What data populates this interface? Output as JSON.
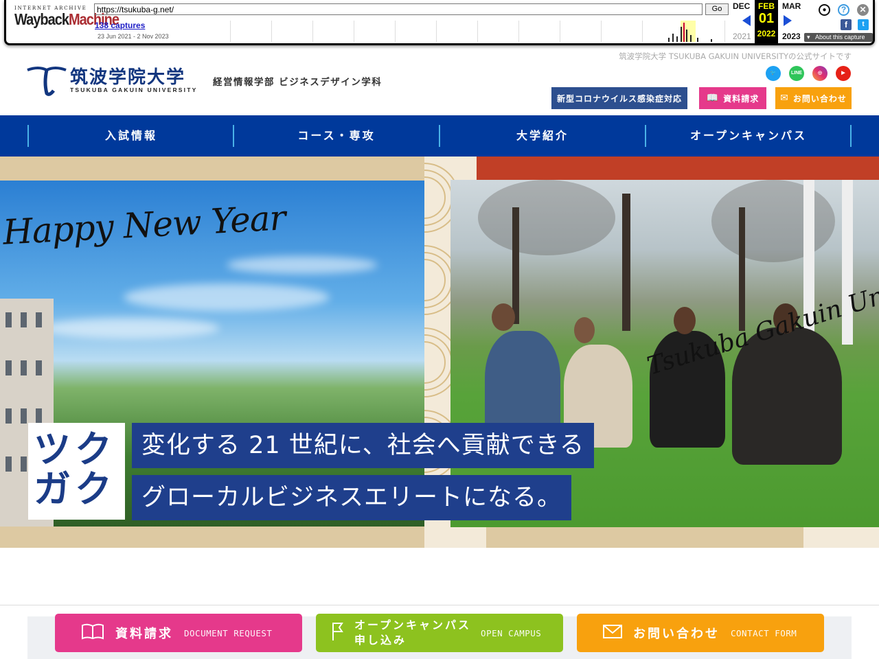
{
  "wayback": {
    "logo_top": "INTERNET ARCHIVE",
    "logo_main_a": "Wayback",
    "logo_main_b": "Machine",
    "url": "https://tsukuba-g.net/",
    "go_label": "Go",
    "captures": "138 captures",
    "range": "23 Jun 2021 - 2 Nov 2023",
    "prev_month": "DEC",
    "cur_month": "FEB",
    "next_month": "MAR",
    "cur_day": "01",
    "prev_year": "2021",
    "cur_year": "2022",
    "next_year": "2023",
    "about": "About this capture"
  },
  "header": {
    "tagline": "筑波学院大学 TSUKUBA GAKUIN UNIVERSITYの公式サイトです",
    "logo_title": "筑波学院大学",
    "logo_sub": "TSUKUBA GAKUIN UNIVERSITY",
    "department": "経営情報学部 ビジネスデザイン学科",
    "social": [
      "twitter",
      "LINE",
      "instagram",
      "youtube"
    ],
    "btn_covid": "新型コロナウイルス感染症対応",
    "btn_request": "資料請求",
    "btn_contact": "お問い合わせ"
  },
  "nav": [
    "入試情報",
    "コース・専攻",
    "大学紹介",
    "オープンキャンパス"
  ],
  "hero": {
    "greeting": "Happy New Year",
    "signature": "Tsukuba Gakuin Un",
    "badge_line1": "ツク",
    "badge_line2": "ガク",
    "copy_line1": "変化する 21 世紀に、社会へ貢献できる",
    "copy_line2": "グローカルビジネスエリートになる。"
  },
  "cta": {
    "request_jp": "資料請求",
    "request_en": "DOCUMENT REQUEST",
    "campus_jp1": "オープンキャンパス",
    "campus_jp2": "申し込み",
    "campus_en": "OPEN CAMPUS",
    "contact_jp": "お問い合わせ",
    "contact_en": "CONTACT FORM"
  },
  "colors": {
    "navy": "#00399b",
    "pink": "#e5398b",
    "green": "#8dc21f",
    "orange": "#f8a10e",
    "covid_btn": "#2d4f8f"
  }
}
